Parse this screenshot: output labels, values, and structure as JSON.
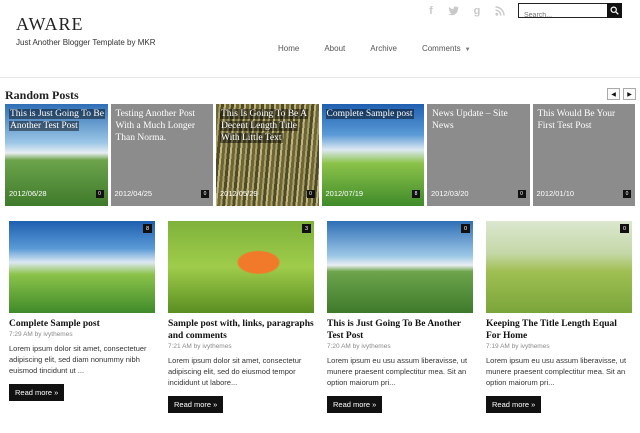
{
  "header": {
    "title": "AWARE",
    "tagline": "Just Another Blogger Template by MKR",
    "search_placeholder": "Search...",
    "social": [
      "facebook-icon",
      "twitter-icon",
      "googleplus-icon",
      "rss-icon"
    ]
  },
  "nav": {
    "items": [
      "Home",
      "About",
      "Archive",
      "Comments"
    ]
  },
  "random_posts": {
    "heading": "Random Posts",
    "prev_arrow": "◀",
    "next_arrow": "▶",
    "items": [
      {
        "title": "This is Just Going To Be Another Test Post",
        "date": "2012/06/28",
        "count": "0",
        "scene": "scene-road"
      },
      {
        "title": "Testing Another Post With a Much Longer Than Norma.",
        "date": "2012/04/25",
        "count": "0",
        "scene": "plain"
      },
      {
        "title": "This Is Going To Be A Decent Length Title With Little Text",
        "date": "2012/05/29",
        "count": "0",
        "scene": "scene-grass"
      },
      {
        "title": "Complete Sample post",
        "date": "2012/07/19",
        "count": "8",
        "scene": "scene-sky"
      },
      {
        "title": "News Update – Site News",
        "date": "2012/03/20",
        "count": "0",
        "scene": "plain"
      },
      {
        "title": "This Would Be Your First Test Post",
        "date": "2012/01/10",
        "count": "0",
        "scene": "plain"
      }
    ]
  },
  "posts": [
    {
      "title": "Complete Sample post",
      "meta": "7:29 AM by ivythemes",
      "excerpt": "Lorem ipsum dolor sit amet, consectetuer adipiscing elit, sed diam nonummy nibh euismod tincidunt ut ...",
      "count": "8",
      "scene": "scene-sky",
      "read_more": "Read more »"
    },
    {
      "title": "Sample post with, links, paragraphs and comments",
      "meta": "7:21 AM by ivythemes",
      "excerpt": "Lorem ipsum dolor sit amet, consectetur adipiscing elit, sed do eiusmod tempor incididunt ut labore...",
      "count": "3",
      "scene": "scene-umbrella",
      "read_more": "Read more »"
    },
    {
      "title": "This is Just Going To Be Another Test Post",
      "meta": "7:20 AM by ivythemes",
      "excerpt": "Lorem ipsum eu usu assum liberavisse, ut munere praesent complectitur mea. Sit an option maiorum pri...",
      "count": "0",
      "scene": "scene-road",
      "read_more": "Read more »"
    },
    {
      "title": "Keeping The Title Length Equal For Home",
      "meta": "7:19 AM by ivythemes",
      "excerpt": "Lorem ipsum eu usu assum liberavisse, ut munere praesent complectitur mea. Sit an option maiorum pri...",
      "count": "0",
      "scene": "scene-field",
      "read_more": "Read more »"
    }
  ]
}
